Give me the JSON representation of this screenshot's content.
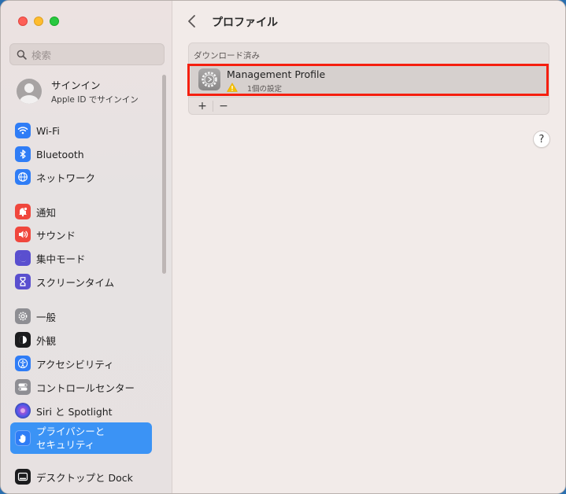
{
  "search": {
    "placeholder": "検索"
  },
  "account": {
    "title": "サインイン",
    "subtitle": "Apple ID でサインイン"
  },
  "sidebar": {
    "items": [
      {
        "label": "Wi-Fi",
        "icon": "wifi-icon",
        "color": "#2f7df6"
      },
      {
        "label": "Bluetooth",
        "icon": "bluetooth-icon",
        "color": "#2f7df6"
      },
      {
        "label": "ネットワーク",
        "icon": "globe-icon",
        "color": "#2f7df6"
      },
      {
        "label": "通知",
        "icon": "bell-icon",
        "color": "#f0473d"
      },
      {
        "label": "サウンド",
        "icon": "speaker-icon",
        "color": "#f0473d"
      },
      {
        "label": "集中モード",
        "icon": "moon-icon",
        "color": "#5a4fcf"
      },
      {
        "label": "スクリーンタイム",
        "icon": "hourglass-icon",
        "color": "#5a4fcf"
      },
      {
        "label": "一般",
        "icon": "gear-icon",
        "color": "#8e8e93"
      },
      {
        "label": "外観",
        "icon": "appearance-icon",
        "color": "#1c1c1e"
      },
      {
        "label": "アクセシビリティ",
        "icon": "accessibility-icon",
        "color": "#2f7df6"
      },
      {
        "label": "コントロールセンター",
        "icon": "toggles-icon",
        "color": "#8e8e93"
      },
      {
        "label": "Siri と Spotlight",
        "icon": "siri-icon",
        "color": "#2b2b44"
      },
      {
        "label": "プライバシーと\nセキュリティ",
        "icon": "hand-icon",
        "color": "#2f7df6"
      },
      {
        "label": "デスクトップと Dock",
        "icon": "dock-icon",
        "color": "#1c1c1e"
      }
    ]
  },
  "main": {
    "title": "プロファイル",
    "section_header": "ダウンロード済み",
    "profile": {
      "name": "Management Profile",
      "count": "1個の設定"
    },
    "add_label": "+",
    "remove_label": "−",
    "help_label": "?"
  }
}
